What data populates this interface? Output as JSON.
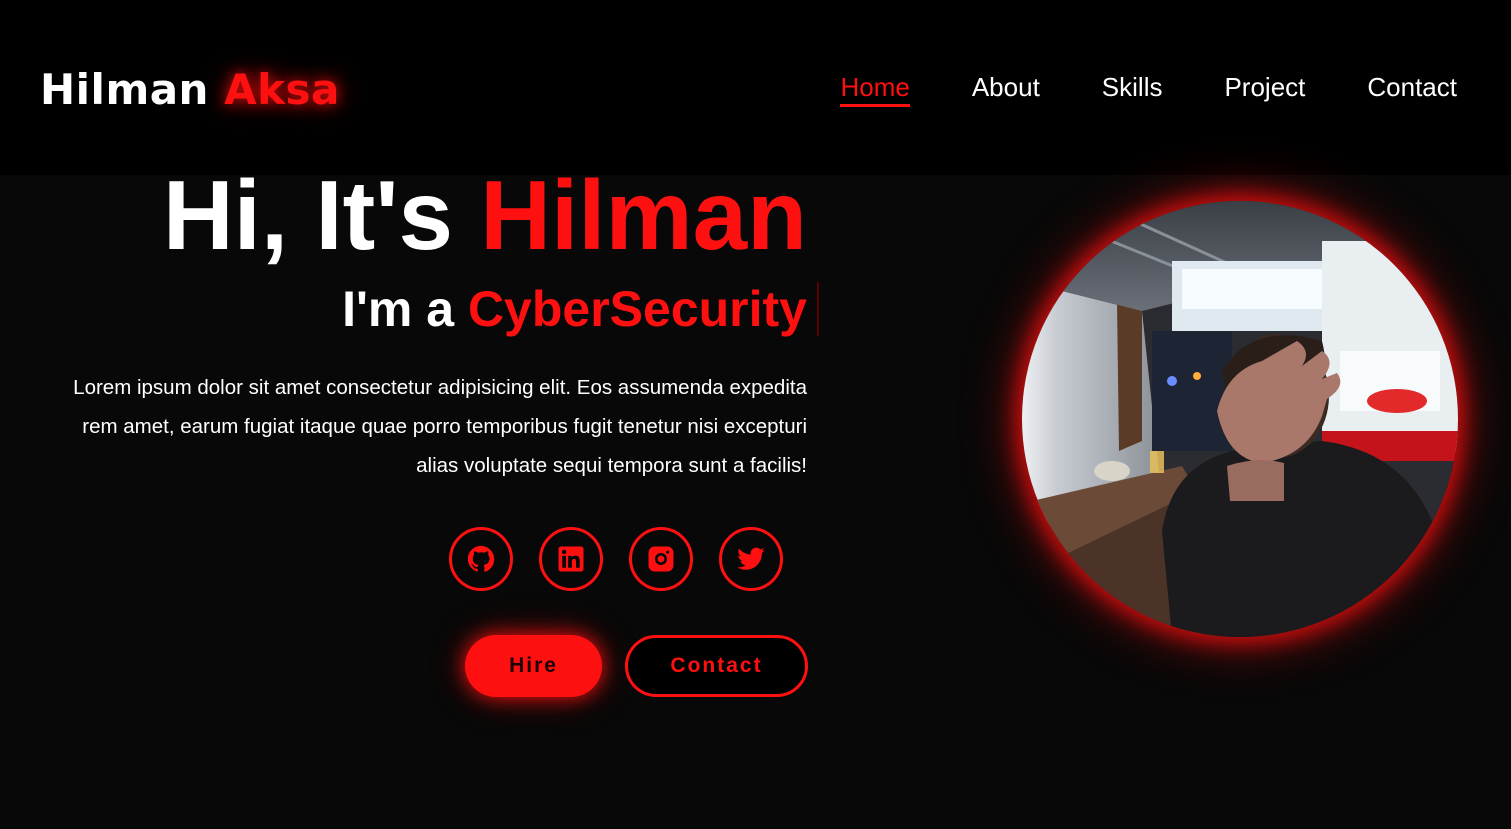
{
  "brand": {
    "first": "Hilman",
    "second": "Aksa"
  },
  "nav": [
    {
      "label": "Home",
      "active": true
    },
    {
      "label": "About",
      "active": false
    },
    {
      "label": "Skills",
      "active": false
    },
    {
      "label": "Project",
      "active": false
    },
    {
      "label": "Contact",
      "active": false
    }
  ],
  "hero": {
    "greeting": "Hi, It's",
    "name": "Hilman",
    "role_prefix": "I'm a",
    "role": "CyberSecurity",
    "description": "Lorem ipsum dolor sit amet consectetur adipisicing elit. Eos assumenda expedita rem amet, earum fugiat itaque quae porro temporibus fugit tenetur nisi excepturi alias voluptate sequi tempora sunt a facilis!"
  },
  "socials": [
    {
      "icon": "github-icon"
    },
    {
      "icon": "linkedin-icon"
    },
    {
      "icon": "instagram-icon"
    },
    {
      "icon": "twitter-icon"
    }
  ],
  "buttons": {
    "hire": "Hire",
    "contact": "Contact"
  },
  "colors": {
    "accent": "#ff1010",
    "background": "#080808",
    "header": "#000000",
    "text": "#ffffff"
  }
}
